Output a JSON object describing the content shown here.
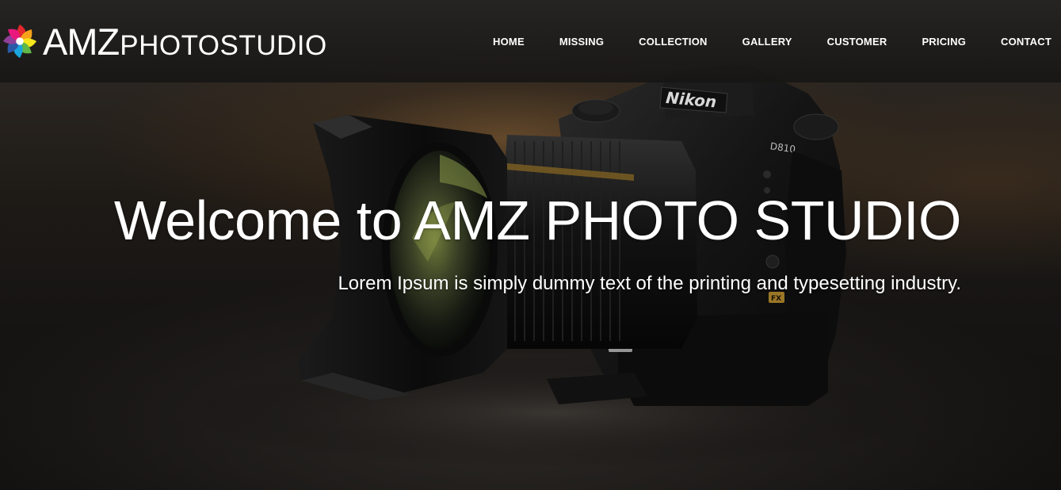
{
  "brand": {
    "name_strong": "AMZ",
    "name_light": "PHOTOSTUDIO",
    "logo_icon": "flower-logo-icon",
    "logo_colors": [
      "#e2282c",
      "#f7a21b",
      "#f6e61d",
      "#62b846",
      "#1aa5dd",
      "#2b59a8",
      "#8f3f98",
      "#e8187d"
    ]
  },
  "nav": {
    "items": [
      {
        "label": "HOME"
      },
      {
        "label": "MISSING"
      },
      {
        "label": "COLLECTION"
      },
      {
        "label": "GALLERY"
      },
      {
        "label": "CUSTOMER"
      },
      {
        "label": "PRICING"
      },
      {
        "label": "CONTACT"
      }
    ]
  },
  "hero": {
    "title": "Welcome to AMZ PHOTO STUDIO",
    "subtitle": "Lorem Ipsum is simply dummy text of the printing and typesetting industry.",
    "camera_brand": "Nikon",
    "camera_model": "D810",
    "badge_fx": "FX"
  },
  "colors": {
    "nav_text": "#ffffff",
    "nav_background": "#262422",
    "hero_text": "#ffffff"
  }
}
